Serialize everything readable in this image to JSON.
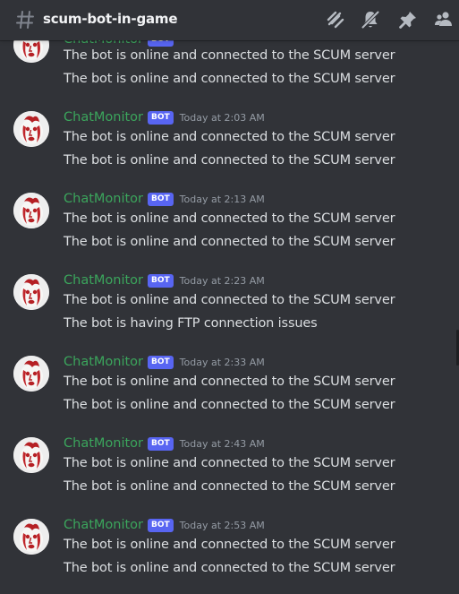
{
  "channel": {
    "name": "scum-bot-in-game"
  },
  "toolbar": {
    "icons": [
      "threads-icon",
      "mute-bell-icon",
      "pin-icon",
      "members-icon"
    ]
  },
  "colors": {
    "background": "#313338",
    "username": "#3ba55c",
    "bot_tag": "#5865f2",
    "text": "#dbdee1",
    "timestamp": "#949ba4"
  },
  "messages": [
    {
      "author": "ChatMonitor",
      "tag": "BOT",
      "time": "",
      "lines": [
        "The bot is online and connected to the SCUM server",
        "The bot is online and connected to the SCUM server"
      ]
    },
    {
      "author": "ChatMonitor",
      "tag": "BOT",
      "time": "Today at 2:03 AM",
      "lines": [
        "The bot is online and connected to the SCUM server",
        "The bot is online and connected to the SCUM server"
      ]
    },
    {
      "author": "ChatMonitor",
      "tag": "BOT",
      "time": "Today at 2:13 AM",
      "lines": [
        "The bot is online and connected to the SCUM server",
        "The bot is online and connected to the SCUM server"
      ]
    },
    {
      "author": "ChatMonitor",
      "tag": "BOT",
      "time": "Today at 2:23 AM",
      "lines": [
        "The bot is online and connected to the SCUM server",
        "The bot is having FTP connection issues"
      ]
    },
    {
      "author": "ChatMonitor",
      "tag": "BOT",
      "time": "Today at 2:33 AM",
      "lines": [
        "The bot is online and connected to the SCUM server",
        "The bot is online and connected to the SCUM server"
      ]
    },
    {
      "author": "ChatMonitor",
      "tag": "BOT",
      "time": "Today at 2:43 AM",
      "lines": [
        "The bot is online and connected to the SCUM server",
        "The bot is online and connected to the SCUM server"
      ]
    },
    {
      "author": "ChatMonitor",
      "tag": "BOT",
      "time": "Today at 2:53 AM",
      "lines": [
        "The bot is online and connected to the SCUM server",
        "The bot is online and connected to the SCUM server"
      ]
    }
  ]
}
